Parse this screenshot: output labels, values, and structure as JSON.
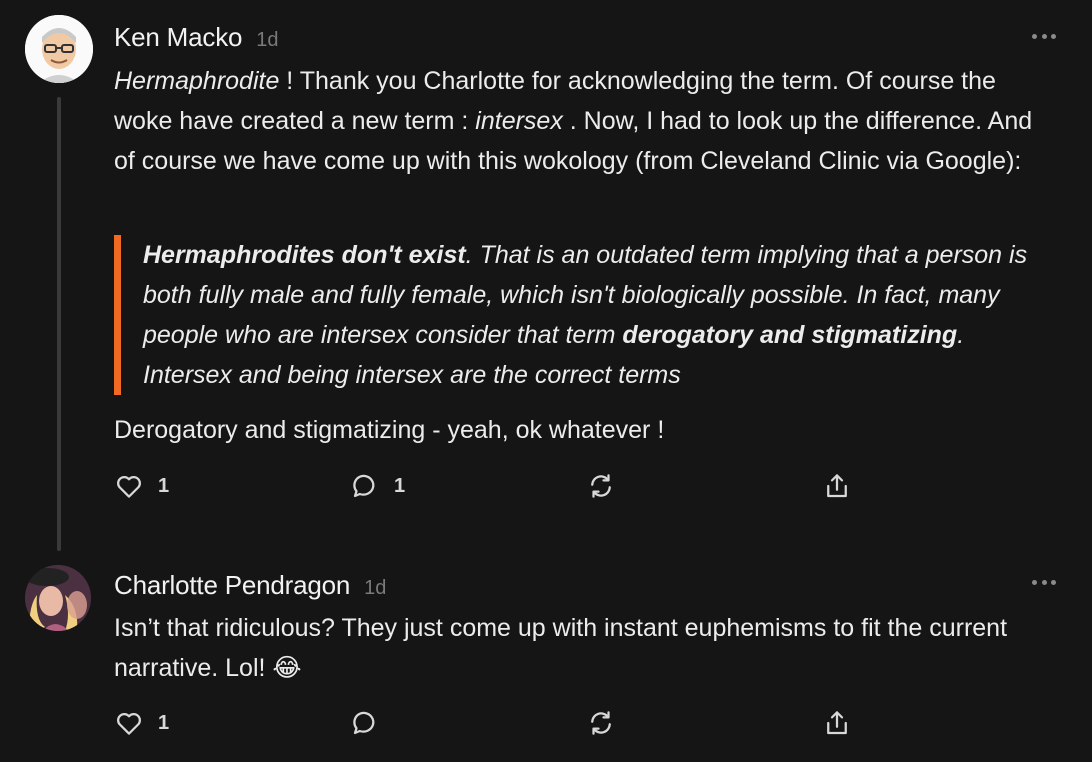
{
  "comments": [
    {
      "author": "Ken Macko",
      "time": "1d",
      "paragraph1": {
        "t1": "Hermaphrodite",
        "t2": " ! Thank you Charlotte for acknowledging the term. Of course the woke have created a new term : ",
        "t3": "intersex",
        "t4": " . Now, I had to look up the difference. And of course we have come up with this wokology (from Cleveland Clinic via Google):"
      },
      "quote": {
        "b1": "Hermaphrodites don't exist",
        "t1": ". That is an outdated term implying that a person is both fully male and fully female, which isn't biologically possible. In fact, many people who are intersex consider that term ",
        "b2": "derogatory and stigmatizing",
        "t2": ". Intersex and being intersex are the correct terms"
      },
      "paragraph2": "Derogatory and stigmatizing - yeah, ok whatever !",
      "likes": "1",
      "replies": "1"
    },
    {
      "author": "Charlotte Pendragon",
      "time": "1d",
      "text": "Isn’t that ridiculous? They just come up with instant euphemisms to fit the current narrative. Lol! 😂",
      "likes": "1"
    }
  ],
  "colors": {
    "accent": "#f26a21",
    "background": "#151515",
    "text": "#ececec",
    "muted": "#7a7a7a"
  },
  "icons": [
    "heart-icon",
    "speech-bubble-icon",
    "restack-icon",
    "share-icon",
    "more-dots-icon"
  ]
}
